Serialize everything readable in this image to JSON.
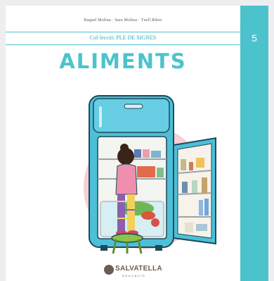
{
  "cover": {
    "authors": "Raquel Molina · Sara Molina · Txell Ribes",
    "collection": "Col·lecció: PLE DE SIGNES",
    "volume_number": "5",
    "title": "ALIMENTS",
    "publisher": {
      "name": "SALVATELLA",
      "subtitle": "EDUCACIÓ"
    }
  },
  "colors": {
    "accent": "#4cc3cc",
    "circle": "#f6cfd3",
    "fridge": "#4dbfd8",
    "publisher": "#6d5b55"
  }
}
